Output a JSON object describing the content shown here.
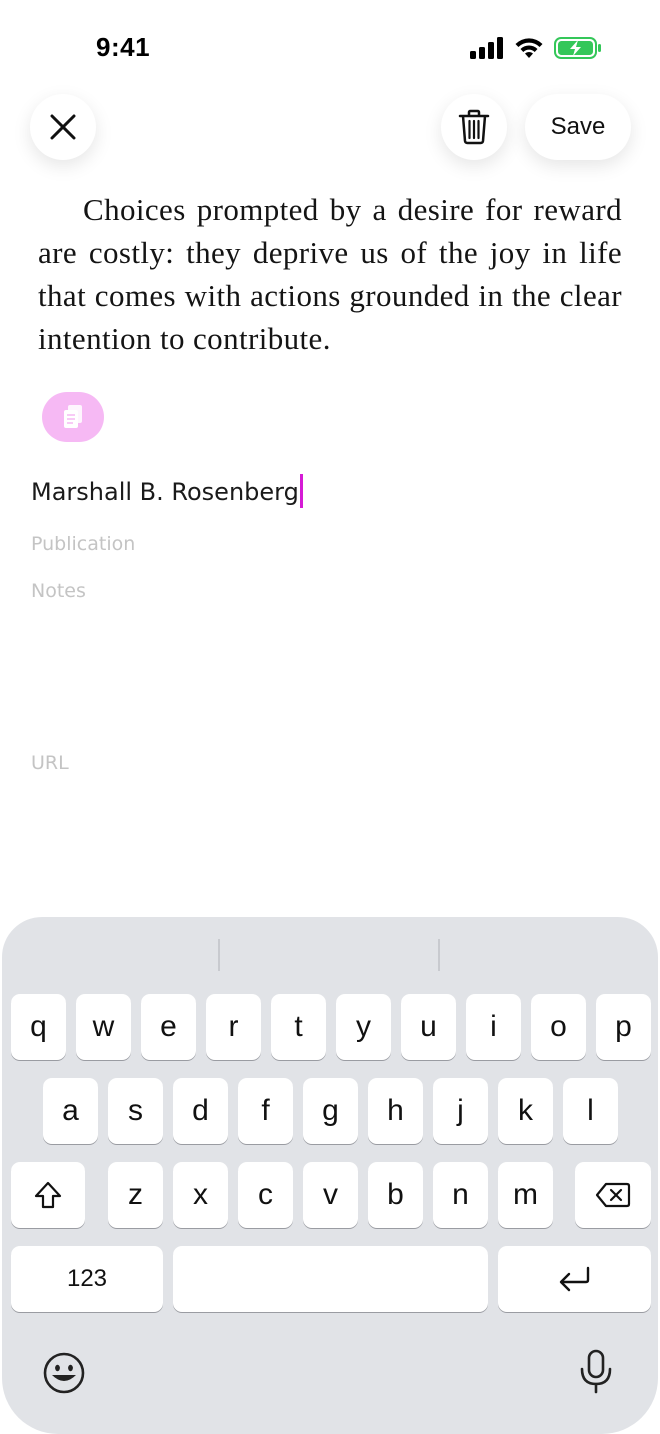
{
  "status_bar": {
    "time": "9:41"
  },
  "toolbar": {
    "save_label": "Save"
  },
  "quote": {
    "text": "Choices prompted by a desire for reward are costly: they deprive us of the joy in life that comes with actions grounded in the clear intention to contribute."
  },
  "fields": {
    "author_value": "Marshall B. Rosenberg",
    "publication_placeholder": "Publication",
    "notes_placeholder": "Notes",
    "url_placeholder": "URL"
  },
  "keyboard": {
    "row1": [
      "q",
      "w",
      "e",
      "r",
      "t",
      "y",
      "u",
      "i",
      "o",
      "p"
    ],
    "row2": [
      "a",
      "s",
      "d",
      "f",
      "g",
      "h",
      "j",
      "k",
      "l"
    ],
    "row3": [
      "z",
      "x",
      "c",
      "v",
      "b",
      "n",
      "m"
    ],
    "numbers_label": "123"
  },
  "colors": {
    "accent": "#d51bd5",
    "chip": "#f6b9f4",
    "battery": "#34c759"
  }
}
